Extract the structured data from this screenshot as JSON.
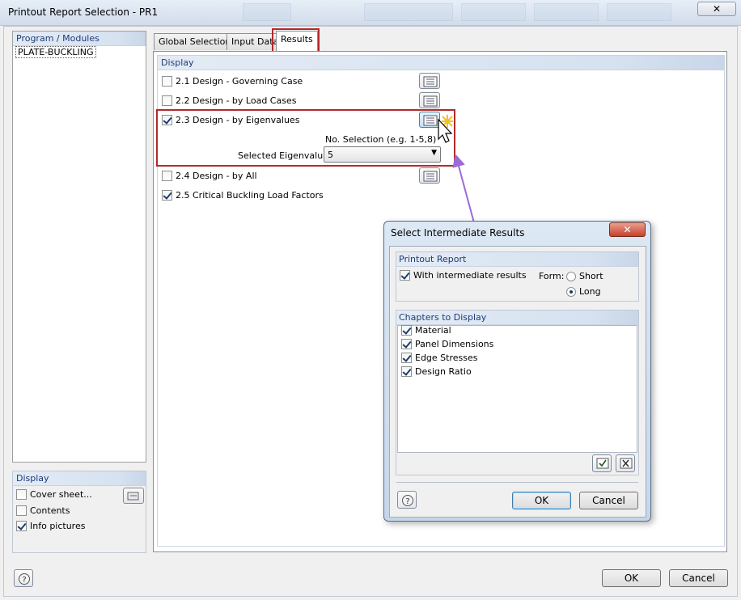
{
  "window": {
    "title": "Printout Report Selection - PR1",
    "close_glyph": "✕"
  },
  "program_modules": {
    "header": "Program / Modules",
    "items": [
      "PLATE-BUCKLING"
    ]
  },
  "left_display": {
    "header": "Display",
    "cover_sheet": {
      "label": "Cover sheet...",
      "checked": false
    },
    "contents": {
      "label": "Contents",
      "checked": false
    },
    "info_pictures": {
      "label": "Info pictures",
      "checked": true
    }
  },
  "tabs": {
    "global": "Global Selection",
    "input": "Input Data",
    "results": "Results"
  },
  "display": {
    "header": "Display",
    "items": [
      {
        "label": "2.1 Design - Governing Case",
        "checked": false
      },
      {
        "label": "2.2 Design - by Load Cases",
        "checked": false
      },
      {
        "label": "2.3 Design - by Eigenvalues",
        "checked": true
      },
      {
        "label": "2.4 Design - by All",
        "checked": false
      },
      {
        "label": "2.5 Critical Buckling Load Factors",
        "checked": true
      }
    ],
    "no_selection_hint": "No. Selection (e.g. 1-5,8)",
    "selected_eigenvalue_label": "Selected Eigenvalue:",
    "selected_eigenvalue_value": "5"
  },
  "dialog": {
    "title": "Select Intermediate Results",
    "close_glyph": "✕",
    "printout_report": {
      "header": "Printout Report",
      "with_intermediate": {
        "label": "With intermediate results",
        "checked": true
      },
      "form_label": "Form:",
      "short": "Short",
      "long": "Long",
      "selected_form": "Long"
    },
    "chapters": {
      "header": "Chapters to Display",
      "items": [
        {
          "label": "Material",
          "checked": true
        },
        {
          "label": "Panel Dimensions",
          "checked": true
        },
        {
          "label": "Edge Stresses",
          "checked": true
        },
        {
          "label": "Design Ratio",
          "checked": true
        }
      ]
    },
    "ok": "OK",
    "cancel": "Cancel"
  },
  "footer": {
    "ok": "OK",
    "cancel": "Cancel"
  },
  "colors": {
    "highlight_red": "#b22a2a",
    "arrow_purple": "#9b6bd8",
    "section_text": "#1e3c78"
  }
}
